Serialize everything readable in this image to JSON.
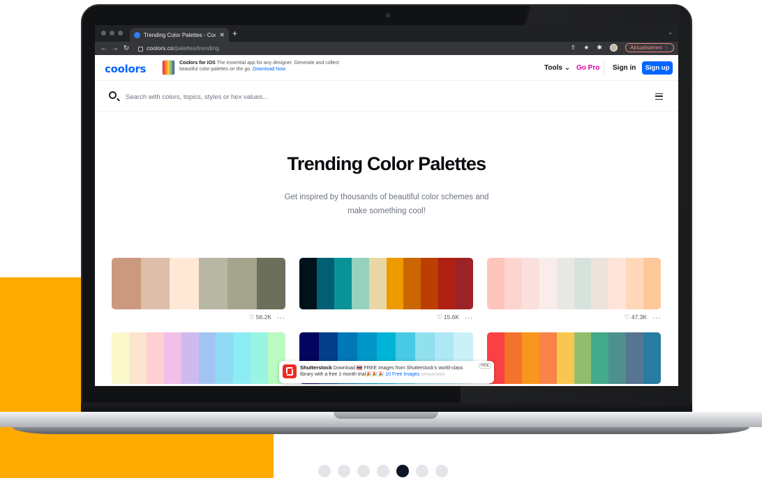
{
  "browser": {
    "tab_title": "Trending Color Palettes - Cool",
    "tab_close": "✕",
    "new_tab": "+",
    "tab_menu": "⌄",
    "url_host": "coolors.co",
    "url_path": "/palettes/trending",
    "update_button": "Aktualisieren ⋮"
  },
  "header": {
    "logo": "coolors",
    "promo_title": "Coolors for iOS",
    "promo_text": "The essential app for any designer. Generate and collect beautiful color palettes on the go.",
    "promo_link": "Download Now",
    "tools_label": "Tools ⌄",
    "gopro_label": "Go Pro",
    "signin_label": "Sign in",
    "signup_label": "Sign up"
  },
  "search": {
    "placeholder": "Search with colors, topics, styles or hex values..."
  },
  "hero": {
    "title": "Trending Color Palettes",
    "subtitle": "Get inspired by thousands of beautiful color schemes and make something cool!"
  },
  "palettes": [
    {
      "likes": "56.2K",
      "colors": [
        "#cb997e",
        "#ddbea9",
        "#ffe8d6",
        "#b7b7a4",
        "#a5a58d",
        "#6b705c"
      ]
    },
    {
      "likes": "15.6K",
      "colors": [
        "#001219",
        "#005f73",
        "#0a9396",
        "#94d2bd",
        "#e9d8a6",
        "#ee9b00",
        "#ca6702",
        "#bb3e03",
        "#ae2012",
        "#9b2226"
      ]
    },
    {
      "likes": "47.3K",
      "colors": [
        "#fec5bb",
        "#fcd5ce",
        "#fae1dd",
        "#f8edeb",
        "#e8e8e4",
        "#d8e2dc",
        "#ece4db",
        "#ffe5d9",
        "#ffd7ba",
        "#fec89a"
      ]
    },
    {
      "likes": "",
      "colors": [
        "#fbf8cc",
        "#fde4cf",
        "#ffcfd2",
        "#f1c0e8",
        "#cfbaf0",
        "#a3c4f3",
        "#90dbf4",
        "#8eecf5",
        "#98f5e1",
        "#b9fbc0"
      ]
    },
    {
      "likes": "",
      "colors": [
        "#03045e",
        "#023e8a",
        "#0077b6",
        "#0096c7",
        "#00b4d8",
        "#48cae4",
        "#90e0ef",
        "#ade8f4",
        "#caf0f8"
      ]
    },
    {
      "likes": "",
      "colors": [
        "#f94144",
        "#f3722c",
        "#f8961e",
        "#f9844a",
        "#f9c74f",
        "#90be6d",
        "#43aa8b",
        "#4d908e",
        "#577590",
        "#277da1"
      ]
    }
  ],
  "ad": {
    "brand": "Shutterstock",
    "text": "Download 🇹🇭 FREE images from Shutterstock's world-class library with a free 1-month trial🎉🎉🎉",
    "link": "10 Free Images",
    "sponsored": "SPONSORED",
    "hide": "HIDE"
  },
  "pager": {
    "count": 7,
    "active_index": 4
  }
}
